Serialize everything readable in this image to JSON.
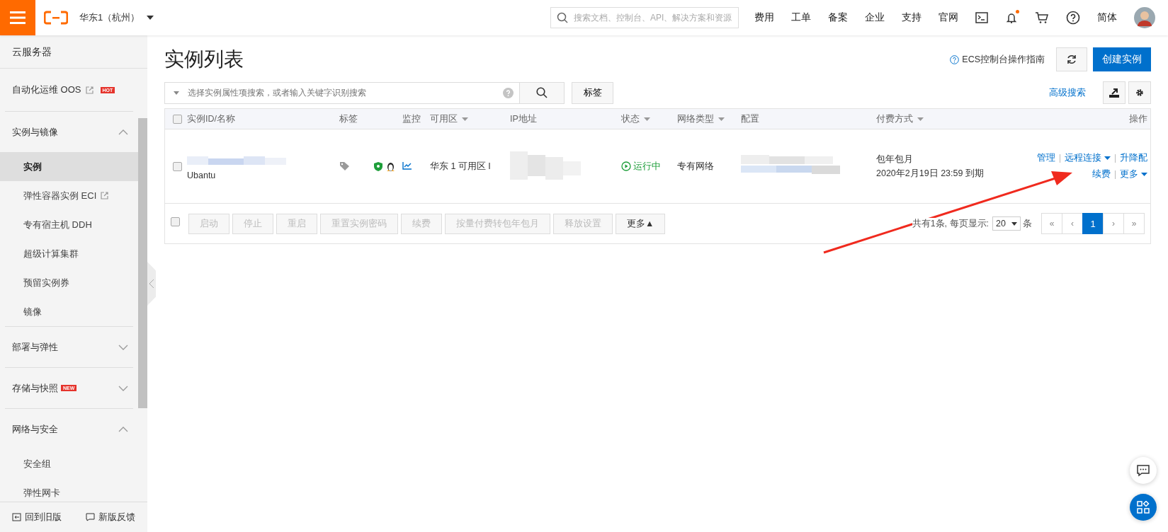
{
  "topbar": {
    "region": "华东1（杭州）",
    "search_placeholder": "搜索文档、控制台、API、解决方案和资源",
    "nav": [
      "费用",
      "工单",
      "备案",
      "企业",
      "支持",
      "官网"
    ],
    "notification": true,
    "language": "简体"
  },
  "sidebar": {
    "title": "云服务器",
    "top_items": [
      {
        "label": "自动化运维 OOS",
        "external": true,
        "badge": "HOT"
      }
    ],
    "groups": [
      {
        "title": "实例与镜像",
        "expanded": true,
        "children": [
          {
            "label": "实例",
            "selected": true,
            "external": false
          },
          {
            "label": "弹性容器实例 ECI",
            "selected": false,
            "external": true
          },
          {
            "label": "专有宿主机 DDH",
            "selected": false,
            "external": false
          },
          {
            "label": "超级计算集群",
            "selected": false,
            "external": false
          },
          {
            "label": "预留实例券",
            "selected": false,
            "external": false
          },
          {
            "label": "镜像",
            "selected": false,
            "external": false
          }
        ]
      },
      {
        "title": "部署与弹性",
        "expanded": false
      },
      {
        "title": "存储与快照",
        "badge": "NEW",
        "expanded": false
      },
      {
        "title": "网络与安全",
        "expanded": true,
        "children": [
          {
            "label": "安全组",
            "selected": false,
            "external": false
          },
          {
            "label": "弹性网卡",
            "selected": false,
            "external": false
          }
        ]
      }
    ],
    "footer": [
      "回到旧版",
      "新版反馈"
    ]
  },
  "page": {
    "title": "实例列表",
    "guide_link": "ECS控制台操作指南",
    "create_button": "创建实例",
    "search_placeholder": "选择实例属性项搜索，或者输入关键字识别搜索",
    "tag_button": "标签",
    "advanced_search": "高级搜索"
  },
  "table": {
    "header_checked": false,
    "columns": [
      {
        "label": "实例ID/名称",
        "sortable": false
      },
      {
        "label": "标签",
        "sortable": false
      },
      {
        "label": "监控",
        "sortable": false
      },
      {
        "label": "可用区",
        "sortable": true
      },
      {
        "label": "IP地址",
        "sortable": false
      },
      {
        "label": "状态",
        "sortable": true
      },
      {
        "label": "网络类型",
        "sortable": true
      },
      {
        "label": "配置",
        "sortable": false
      },
      {
        "label": "付费方式",
        "sortable": true
      },
      {
        "label": "操作",
        "sortable": false
      }
    ],
    "rows": [
      {
        "checked": false,
        "name": "Ubantu",
        "zone": "华东 1 可用区 I",
        "status": "运行中",
        "network": "专有网络",
        "billing": "包年包月",
        "expiry": "2020年2月19日 23:59 到期",
        "actions": [
          [
            {
              "label": "管理",
              "dropdown": false
            },
            {
              "label": "远程连接",
              "dropdown": true
            },
            {
              "label": "升降配",
              "dropdown": false
            }
          ],
          [
            {
              "label": "续费",
              "dropdown": false
            },
            {
              "label": "更多",
              "dropdown": true
            }
          ]
        ]
      }
    ]
  },
  "bulk": {
    "checked": false,
    "buttons": [
      {
        "label": "启动",
        "disabled": true
      },
      {
        "label": "停止",
        "disabled": true
      },
      {
        "label": "重启",
        "disabled": true
      },
      {
        "label": "重置实例密码",
        "disabled": true
      },
      {
        "label": "续费",
        "disabled": true
      },
      {
        "label": "按量付费转包年包月",
        "disabled": true
      },
      {
        "label": "释放设置",
        "disabled": true
      },
      {
        "label": "更多▲",
        "disabled": false
      }
    ]
  },
  "pagination": {
    "summary": "共有1条, 每页显示:",
    "page_size": "20",
    "unit": "条",
    "pages": [
      {
        "label": "«",
        "selected": false
      },
      {
        "label": "‹",
        "selected": false
      },
      {
        "label": "1",
        "selected": true
      },
      {
        "label": "›",
        "selected": false
      },
      {
        "label": "»",
        "selected": false
      }
    ]
  }
}
